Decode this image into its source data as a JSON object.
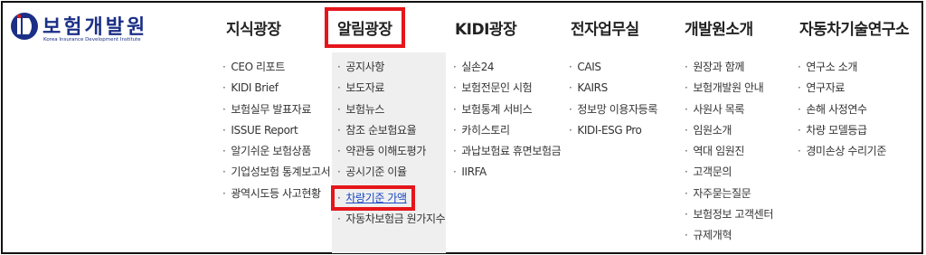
{
  "logo": {
    "korean": "보험개발원",
    "english": "Korea Insurance Development Institute"
  },
  "nav": [
    {
      "title": "지식광장",
      "items": [
        "CEO 리포트",
        "KIDI Brief",
        "보험실무 발표자료",
        "ISSUE Report",
        "알기쉬운 보험상품",
        "기업성보험 통계보고서",
        "광역시도등 사고현황"
      ]
    },
    {
      "title": "알림광장",
      "items": [
        "공지사항",
        "보도자료",
        "보험뉴스",
        "참조 순보험요율",
        "약관등 이해도평가",
        "공시기준 이율",
        "차량기준 가액",
        "자동차보험금 원가지수"
      ]
    },
    {
      "title": "KIDI광장",
      "items": [
        "실손24",
        "보험전문인 시험",
        "보험통계 서비스",
        "카히스토리",
        "과납보험료 휴면보험금",
        "IIRFA"
      ]
    },
    {
      "title": "전자업무실",
      "items": [
        "CAIS",
        "KAIRS",
        "정보망 이용자등록",
        "KIDI-ESG Pro"
      ]
    },
    {
      "title": "개발원소개",
      "items": [
        "원장과 함께",
        "보험개발원 안내",
        "사원사 목록",
        "임원소개",
        "역대 임원진",
        "고객문의",
        "자주묻는질문",
        "보험정보 고객센터",
        "규제개혁"
      ]
    },
    {
      "title": "자동차기술연구소",
      "items": [
        "연구소 소개",
        "연구자료",
        "손해 사정연수",
        "차량 모델등급",
        "경미손상 수리기준"
      ]
    }
  ],
  "bullet": "·",
  "colors": {
    "highlight": "#e5161b",
    "link": "#1848c2",
    "brand": "#1b2f86",
    "active_column_bg": "#efefef"
  }
}
